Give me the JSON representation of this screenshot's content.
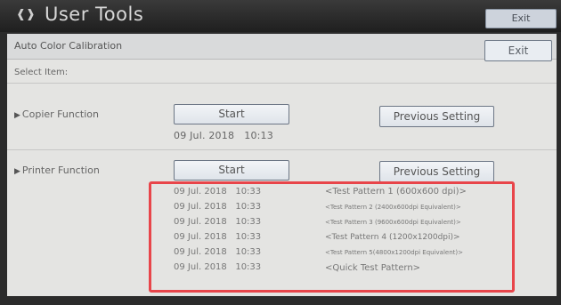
{
  "header": {
    "title": "User Tools",
    "exit_label": "Exit"
  },
  "screen": {
    "title": "Auto Color Calibration",
    "exit_label": "Exit",
    "select_label": "Select Item:"
  },
  "copier": {
    "label": "Copier Function",
    "start_label": "Start",
    "previous_label": "Previous Setting",
    "date": "09 Jul. 2018",
    "time": "10:13"
  },
  "printer": {
    "label": "Printer Function",
    "start_label": "Start",
    "previous_label": "Previous Setting",
    "log": [
      {
        "date": "09 Jul. 2018",
        "time": "10:33",
        "pattern": "<Test Pattern 1 (600x600 dpi)>"
      },
      {
        "date": "09 Jul. 2018",
        "time": "10:33",
        "pattern": "<Test Pattern 2 (2400x600dpi Equivalent)>"
      },
      {
        "date": "09 Jul. 2018",
        "time": "10:33",
        "pattern": "<Test Pattern 3 (9600x600dpi Equivalent)>"
      },
      {
        "date": "09 Jul. 2018",
        "time": "10:33",
        "pattern": "<Test Pattern 4 (1200x1200dpi)>"
      },
      {
        "date": "09 Jul. 2018",
        "time": "10:33",
        "pattern": "<Test Pattern 5(4800x1200dpi Equivalent)>"
      },
      {
        "date": "09 Jul. 2018",
        "time": "10:33",
        "pattern": "<Quick Test Pattern>"
      }
    ]
  },
  "colors": {
    "highlight": "#e8454a",
    "title_bar": "#2b2b2b"
  }
}
